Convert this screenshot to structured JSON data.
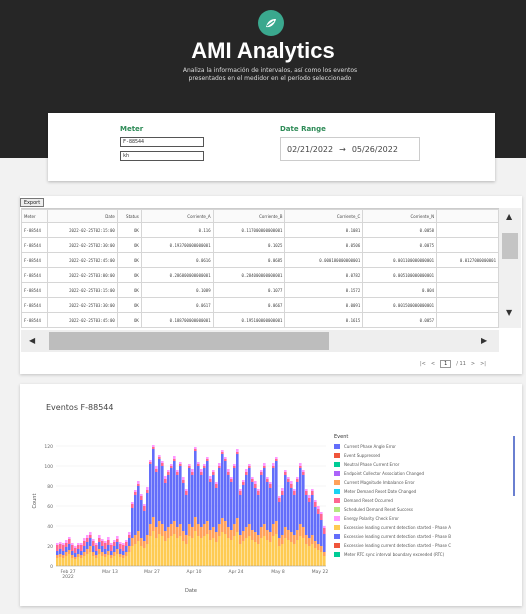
{
  "header": {
    "title": "AMI Analytics",
    "subtitle": "Analiza la información de intervalos, así como los eventos presentados en el medidor en el período seleccionado"
  },
  "filters": {
    "meter_label": "Meter",
    "meter_value": "F-88544",
    "meter_value_2": "kh",
    "date_label": "Date Range",
    "start_date": "02/21/2022",
    "end_date": "05/26/2022"
  },
  "table": {
    "export_label": "Export",
    "columns": [
      "Meter",
      "Date",
      "Status",
      "Corriente_A",
      "Corriente_B",
      "Corriente_C",
      "Corriente_N",
      ""
    ],
    "rows": [
      [
        "F-88544",
        "2022-02-25T02:15:00",
        "OK",
        "0.116",
        "0.117000000000001",
        "0.1081",
        "0.0058",
        ""
      ],
      [
        "F-88544",
        "2022-02-25T02:30:00",
        "OK",
        "0.193700000000001",
        "0.1025",
        "0.0506",
        "0.0075",
        ""
      ],
      [
        "F-88544",
        "2022-02-25T02:45:00",
        "OK",
        "0.0616",
        "0.0685",
        "0.000180000000001",
        "0.001100000000001",
        "0.0127000000001"
      ],
      [
        "F-88544",
        "2022-02-25T03:00:00",
        "OK",
        "0.286000000000001",
        "0.284000000000001",
        "0.0782",
        "0.005100000000001",
        ""
      ],
      [
        "F-88544",
        "2022-02-25T03:15:00",
        "OK",
        "0.1089",
        "0.1077",
        "0.1572",
        "0.004",
        ""
      ],
      [
        "F-88544",
        "2022-02-25T03:30:00",
        "OK",
        "0.0617",
        "0.0667",
        "0.0091",
        "0.001500000000001",
        ""
      ],
      [
        "F-88544",
        "2022-02-25T03:45:00",
        "OK",
        "0.188700000000001",
        "0.195100000000001",
        "0.1615",
        "0.0057",
        ""
      ]
    ],
    "pager": {
      "first": "|<",
      "prev": "<",
      "page": "1",
      "total": "/ 11",
      "next": ">",
      "last": ">|"
    }
  },
  "chart": {
    "title": "Eventos F-88544",
    "legend_title": "Event",
    "legend": [
      {
        "name": "Current Phase Angle Error",
        "color": "#636efa"
      },
      {
        "name": "Event Suppressed",
        "color": "#ef553b"
      },
      {
        "name": "Neutral Phase Current Error",
        "color": "#00cc96"
      },
      {
        "name": "Endpoint Collector Association Changed",
        "color": "#ab63fa"
      },
      {
        "name": "Current Magnitude Imbalance Error",
        "color": "#ffa15a"
      },
      {
        "name": "Meter Demand Reset Date Changed",
        "color": "#19d3f3"
      },
      {
        "name": "Demand Reset Occurred",
        "color": "#ff6692"
      },
      {
        "name": "Scheduled Demand Reset Success",
        "color": "#b6e880"
      },
      {
        "name": "Energy Polarity Check Error",
        "color": "#ff97ff"
      },
      {
        "name": "Excessive leading current detection started - Phase A",
        "color": "#fecb52"
      },
      {
        "name": "Excessive leading current detection started - Phase B",
        "color": "#636efa"
      },
      {
        "name": "Excessive leading current detection started - Phase C",
        "color": "#ef553b"
      },
      {
        "name": "Meter RTC sync interval boundary exceeded (RTC)",
        "color": "#00cc96"
      }
    ]
  },
  "chart_data": {
    "type": "bar",
    "title": "Eventos F-88544",
    "xlabel": "Date",
    "ylabel": "Count",
    "ylim": [
      0,
      130
    ],
    "yticks": [
      0,
      20,
      40,
      60,
      80,
      100,
      120
    ],
    "xticks": [
      "Feb 27\n2022",
      "Mar 13",
      "Mar 27",
      "Apr 10",
      "Apr 24",
      "May 8",
      "May 22"
    ],
    "days": 90,
    "series": [
      {
        "name": "Excessive leading current detection started - Phase A",
        "color": "#fecb52",
        "values": [
          8,
          9,
          8,
          10,
          12,
          8,
          7,
          9,
          8,
          10,
          12,
          14,
          10,
          8,
          12,
          10,
          9,
          11,
          8,
          10,
          12,
          9,
          8,
          10,
          14,
          20,
          22,
          25,
          20,
          18,
          22,
          30,
          35,
          28,
          32,
          30,
          25,
          28,
          30,
          32,
          28,
          30,
          25,
          22,
          30,
          28,
          35,
          30,
          28,
          30,
          32,
          26,
          28,
          24,
          30,
          34,
          32,
          28,
          26,
          30,
          34,
          22,
          25,
          28,
          30,
          26,
          24,
          22,
          28,
          30,
          26,
          24,
          30,
          32,
          20,
          22,
          28,
          26,
          24,
          22,
          26,
          30,
          28,
          22,
          20,
          22,
          18,
          16,
          14,
          10
        ]
      },
      {
        "name": "Current Magnitude Imbalance Error",
        "color": "#ffa15a",
        "values": [
          3,
          3,
          3,
          4,
          4,
          3,
          2,
          3,
          3,
          4,
          5,
          6,
          4,
          3,
          5,
          4,
          3,
          4,
          3,
          4,
          5,
          3,
          3,
          4,
          6,
          8,
          9,
          10,
          8,
          7,
          9,
          12,
          14,
          11,
          13,
          12,
          10,
          11,
          12,
          13,
          11,
          12,
          10,
          9,
          12,
          11,
          14,
          12,
          11,
          12,
          13,
          10,
          11,
          10,
          12,
          14,
          13,
          11,
          10,
          12,
          14,
          9,
          10,
          11,
          12,
          10,
          10,
          9,
          11,
          12,
          10,
          10,
          12,
          13,
          8,
          9,
          11,
          10,
          10,
          9,
          10,
          12,
          11,
          9,
          8,
          9,
          7,
          6,
          6,
          4
        ]
      },
      {
        "name": "Current Phase Angle Error",
        "color": "#636efa",
        "values": [
          4,
          5,
          4,
          5,
          6,
          4,
          4,
          5,
          4,
          6,
          7,
          8,
          6,
          4,
          7,
          6,
          5,
          6,
          4,
          6,
          7,
          5,
          4,
          6,
          8,
          30,
          40,
          45,
          38,
          30,
          42,
          60,
          68,
          55,
          62,
          58,
          48,
          52,
          56,
          60,
          52,
          58,
          48,
          40,
          56,
          52,
          66,
          58,
          52,
          56,
          60,
          48,
          52,
          44,
          56,
          64,
          60,
          52,
          48,
          56,
          64,
          40,
          46,
          52,
          56,
          48,
          44,
          40,
          52,
          56,
          48,
          44,
          56,
          60,
          36,
          40,
          52,
          48,
          44,
          40,
          48,
          56,
          52,
          40,
          36,
          40,
          34,
          30,
          26,
          18
        ]
      },
      {
        "name": "Demand Reset Occurred",
        "color": "#ff6692",
        "values": [
          6,
          5,
          6,
          4,
          5,
          6,
          5,
          4,
          6,
          5,
          4,
          3,
          5,
          6,
          4,
          5,
          6,
          5,
          6,
          4,
          3,
          5,
          6,
          4,
          3,
          4,
          3,
          2,
          4,
          5,
          3,
          2,
          2,
          3,
          2,
          3,
          4,
          3,
          2,
          2,
          3,
          2,
          3,
          4,
          2,
          3,
          2,
          2,
          3,
          2,
          2,
          3,
          3,
          4,
          2,
          2,
          2,
          3,
          3,
          2,
          2,
          4,
          3,
          3,
          2,
          3,
          4,
          4,
          3,
          2,
          3,
          4,
          2,
          2,
          4,
          4,
          3,
          3,
          4,
          4,
          3,
          2,
          3,
          4,
          4,
          4,
          5,
          5,
          6,
          6
        ]
      },
      {
        "name": "Energy Polarity Check Error",
        "color": "#ff97ff",
        "values": [
          2,
          2,
          2,
          3,
          2,
          2,
          2,
          2,
          2,
          3,
          3,
          3,
          2,
          2,
          3,
          2,
          2,
          3,
          2,
          2,
          3,
          2,
          2,
          2,
          3,
          2,
          2,
          3,
          2,
          2,
          3,
          2,
          2,
          3,
          2,
          2,
          3,
          2,
          2,
          3,
          2,
          2,
          3,
          2,
          2,
          3,
          2,
          2,
          3,
          2,
          2,
          3,
          2,
          2,
          3,
          2,
          2,
          3,
          2,
          2,
          3,
          2,
          2,
          3,
          2,
          2,
          3,
          2,
          2,
          3,
          2,
          2,
          3,
          2,
          2,
          3,
          2,
          2,
          3,
          2,
          2,
          3,
          2,
          2,
          3,
          2,
          2,
          3,
          2,
          2
        ]
      }
    ]
  }
}
